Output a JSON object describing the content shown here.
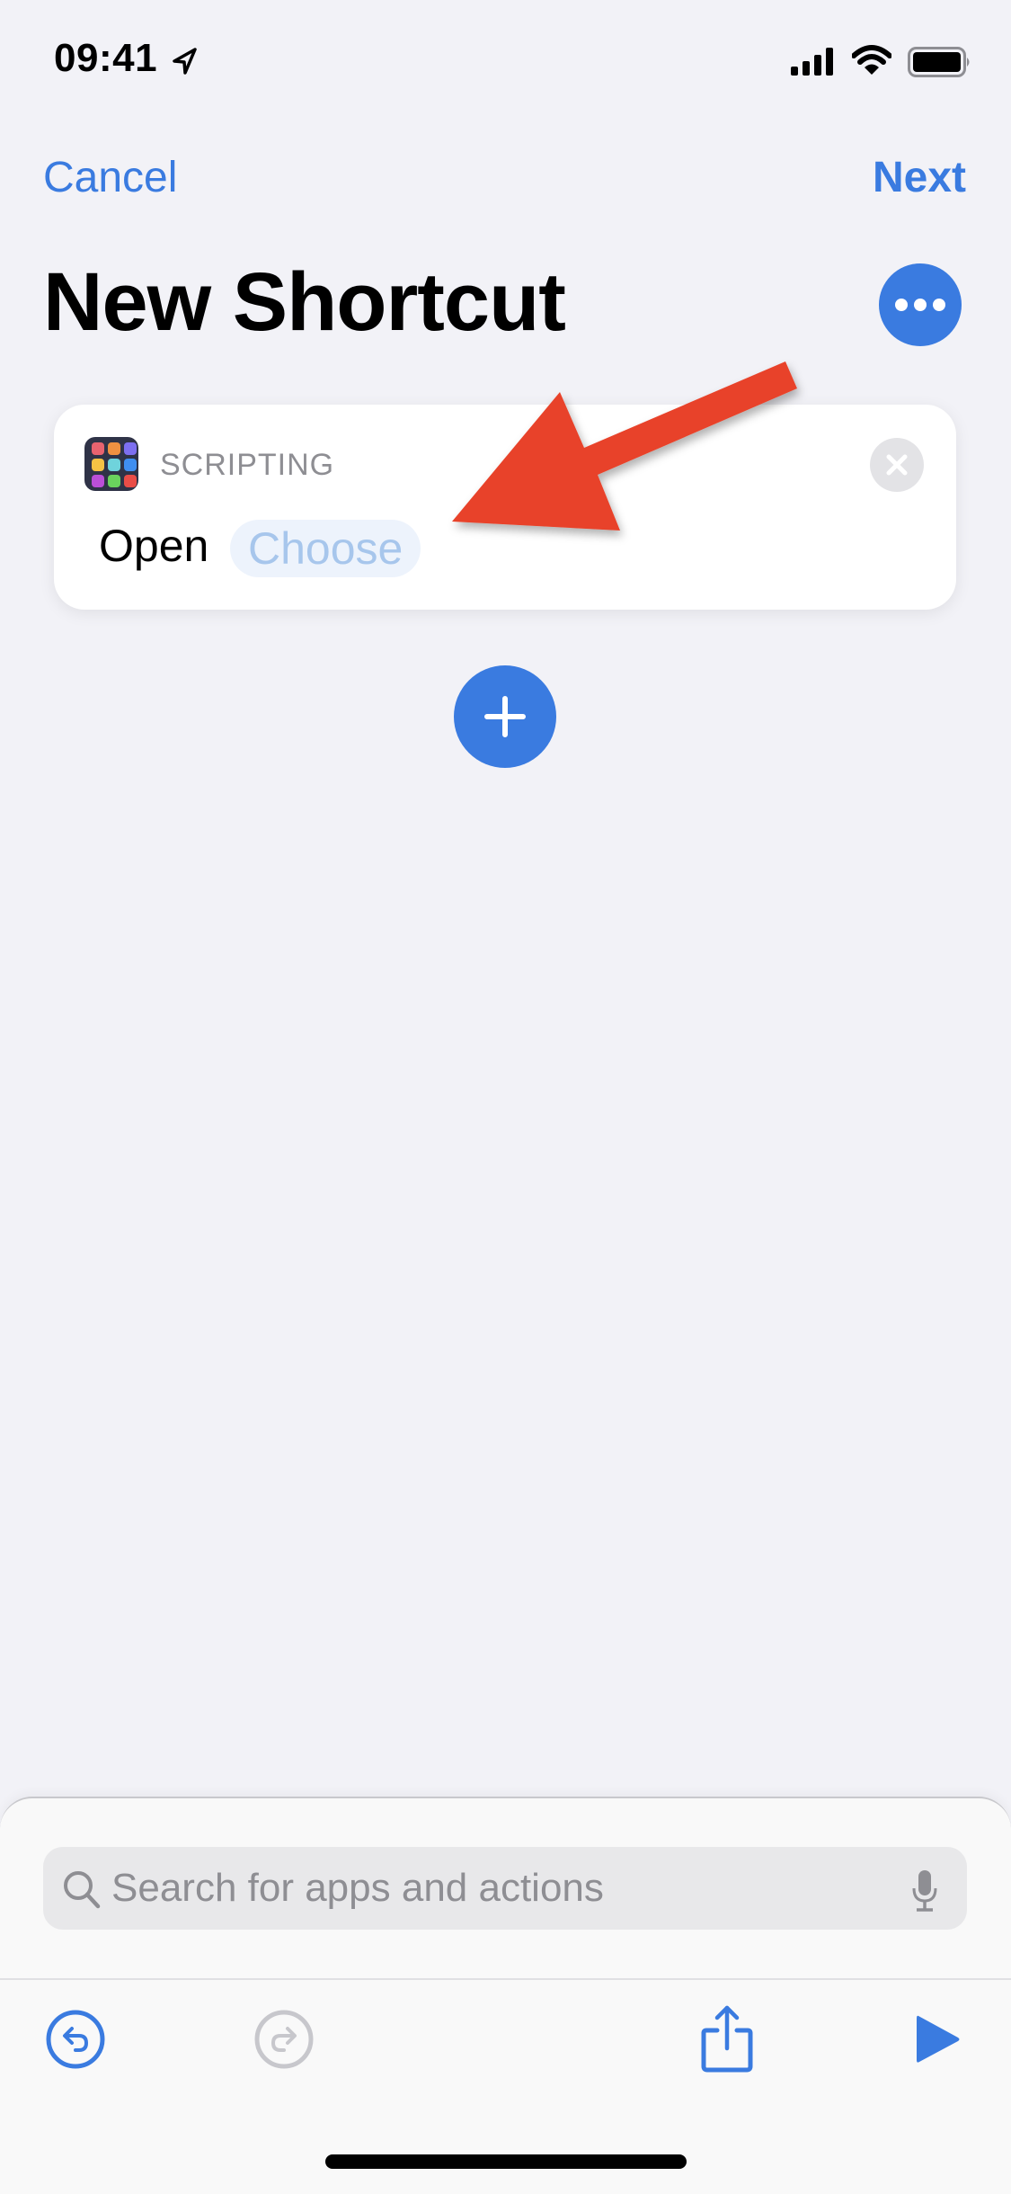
{
  "status_bar": {
    "time": "09:41",
    "location_icon": "location-arrow-icon",
    "signal_icon": "cellular-signal-icon",
    "wifi_icon": "wifi-icon",
    "battery_icon": "battery-full-icon"
  },
  "nav": {
    "cancel_label": "Cancel",
    "next_label": "Next"
  },
  "header": {
    "title": "New Shortcut",
    "more_icon": "ellipsis-icon"
  },
  "action": {
    "category": "SCRIPTING",
    "app_icon": "scripting-grid-icon",
    "app_icon_colors": [
      "#e8636f",
      "#ef9141",
      "#7d6ff0",
      "#f4c244",
      "#6fd3dc",
      "#3f8ef0",
      "#bb4fd8",
      "#6ad35d",
      "#ea4d47"
    ],
    "verb": "Open",
    "parameter_placeholder": "Choose",
    "remove_icon": "close-circle-icon"
  },
  "annotation": {
    "arrow_color": "#e8432a",
    "arrow_icon": "red-arrow-annotation"
  },
  "add_action": {
    "icon": "plus-icon"
  },
  "search": {
    "placeholder": "Search for apps and actions",
    "value": "",
    "search_icon": "magnifying-glass-icon",
    "mic_icon": "microphone-icon"
  },
  "toolbar": {
    "undo_icon": "undo-icon",
    "redo_icon": "redo-icon",
    "share_icon": "share-icon",
    "run_icon": "play-icon",
    "redo_enabled": false,
    "undo_enabled": true
  },
  "colors": {
    "accent": "#3a7be0",
    "background": "#f2f2f7",
    "secondary_text": "#8e8e93",
    "disabled": "#c7c7cc"
  }
}
